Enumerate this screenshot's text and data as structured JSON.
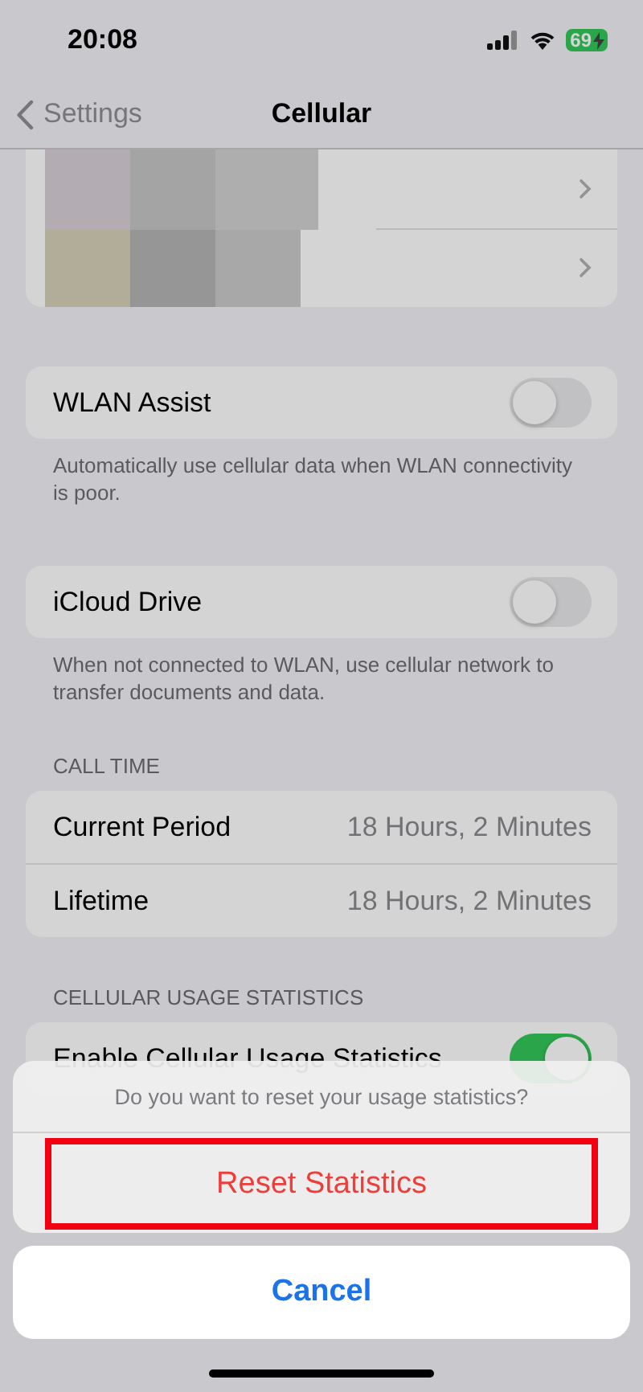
{
  "status_bar": {
    "time": "20:08",
    "battery": "69"
  },
  "nav": {
    "back": "Settings",
    "title": "Cellular"
  },
  "sections": [
    {
      "rows": [
        {
          "kind": "toggle",
          "label": "WLAN Assist",
          "on": false
        }
      ],
      "footer": "Automatically use cellular data when WLAN connectivity is poor."
    },
    {
      "rows": [
        {
          "kind": "toggle",
          "label": "iCloud Drive",
          "on": false
        }
      ],
      "footer": "When not connected to WLAN, use cellular network to transfer documents and data."
    },
    {
      "header": "CALL TIME",
      "rows": [
        {
          "kind": "value",
          "label": "Current Period",
          "value": "18 Hours, 2 Minutes"
        },
        {
          "kind": "value",
          "label": "Lifetime",
          "value": "18 Hours, 2 Minutes"
        }
      ]
    },
    {
      "header": "CELLULAR USAGE STATISTICS",
      "rows": [
        {
          "kind": "toggle",
          "label": "Enable Cellular Usage Statistics",
          "on": true
        }
      ]
    }
  ],
  "sheet": {
    "message": "Do you want to reset your usage statistics?",
    "actions": [
      {
        "label": "Reset Statistics",
        "kind": "destructive",
        "highlighted": true
      }
    ],
    "cancel": "Cancel"
  }
}
